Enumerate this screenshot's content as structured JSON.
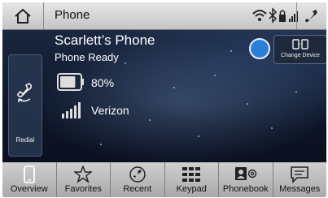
{
  "status_bar": {
    "title": "Phone",
    "icons": [
      "wifi-icon",
      "bluetooth-icon",
      "lock-icon",
      "signal-icon"
    ]
  },
  "device": {
    "name": "Scarlett’s Phone",
    "status": "Phone Ready",
    "battery": "80%",
    "battery_level": 0.8,
    "carrier": "Verizon"
  },
  "buttons": {
    "redial": "Redial",
    "change_device": "Change Device"
  },
  "tabs": [
    {
      "label": "Overview",
      "icon": "phone-device-icon",
      "active": true
    },
    {
      "label": "Favorites",
      "icon": "star-icon",
      "active": false
    },
    {
      "label": "Recent",
      "icon": "recent-calls-icon",
      "active": false
    },
    {
      "label": "Keypad",
      "icon": "keypad-icon",
      "active": false
    },
    {
      "label": "Phonebook",
      "icon": "phonebook-icon",
      "active": false
    },
    {
      "label": "Messages",
      "icon": "message-icon",
      "active": false
    }
  ],
  "colors": {
    "accent": "#2f6fc4",
    "status_dot": "#2b7fd9"
  }
}
